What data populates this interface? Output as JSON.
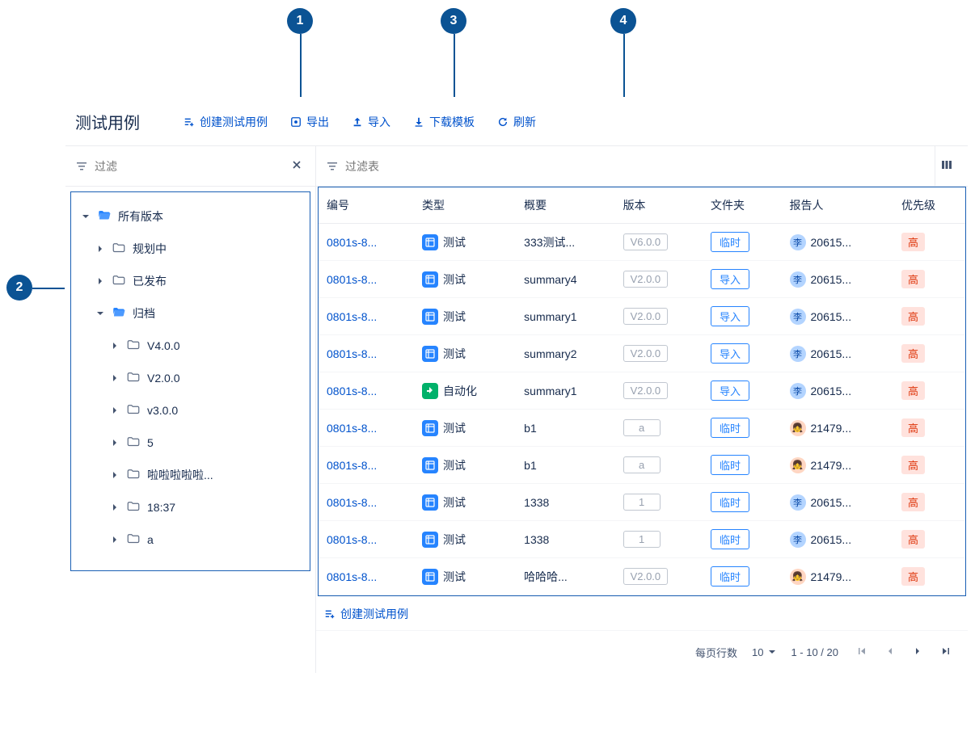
{
  "header": {
    "title": "测试用例",
    "create_label": "创建测试用例",
    "export_label": "导出",
    "import_label": "导入",
    "download_template_label": "下载模板",
    "refresh_label": "刷新"
  },
  "sidebar": {
    "filter_placeholder": "过滤",
    "tree": [
      {
        "depth": 0,
        "expanded": true,
        "open_folder": true,
        "label": "所有版本"
      },
      {
        "depth": 1,
        "expanded": false,
        "open_folder": false,
        "label": "规划中"
      },
      {
        "depth": 1,
        "expanded": false,
        "open_folder": false,
        "label": "已发布"
      },
      {
        "depth": 1,
        "expanded": true,
        "open_folder": true,
        "label": "归档"
      },
      {
        "depth": 2,
        "expanded": false,
        "open_folder": false,
        "label": "V4.0.0"
      },
      {
        "depth": 2,
        "expanded": false,
        "open_folder": false,
        "label": "V2.0.0"
      },
      {
        "depth": 2,
        "expanded": false,
        "open_folder": false,
        "label": "v3.0.0"
      },
      {
        "depth": 2,
        "expanded": false,
        "open_folder": false,
        "label": "5"
      },
      {
        "depth": 2,
        "expanded": false,
        "open_folder": false,
        "label": "啦啦啦啦啦..."
      },
      {
        "depth": 2,
        "expanded": false,
        "open_folder": false,
        "label": "18:37"
      },
      {
        "depth": 2,
        "expanded": false,
        "open_folder": false,
        "label": "a"
      }
    ]
  },
  "content": {
    "filter_placeholder": "过滤表",
    "columns": {
      "id": "编号",
      "type": "类型",
      "summary": "概要",
      "version": "版本",
      "folder": "文件夹",
      "reporter": "报告人",
      "priority": "优先级"
    },
    "rows": [
      {
        "id": "0801s-8...",
        "type_label": "测试",
        "type_variant": "blue",
        "summary": "333测试...",
        "version": "V6.0.0",
        "folder": "临时",
        "reporter": "20615...",
        "avatar": "blue",
        "priority": "高"
      },
      {
        "id": "0801s-8...",
        "type_label": "测试",
        "type_variant": "blue",
        "summary": "summary4",
        "version": "V2.0.0",
        "folder": "导入",
        "reporter": "20615...",
        "avatar": "blue",
        "priority": "高"
      },
      {
        "id": "0801s-8...",
        "type_label": "测试",
        "type_variant": "blue",
        "summary": "summary1",
        "version": "V2.0.0",
        "folder": "导入",
        "reporter": "20615...",
        "avatar": "blue",
        "priority": "高"
      },
      {
        "id": "0801s-8...",
        "type_label": "测试",
        "type_variant": "blue",
        "summary": "summary2",
        "version": "V2.0.0",
        "folder": "导入",
        "reporter": "20615...",
        "avatar": "blue",
        "priority": "高"
      },
      {
        "id": "0801s-8...",
        "type_label": "自动化",
        "type_variant": "green",
        "summary": "summary1",
        "version": "V2.0.0",
        "folder": "导入",
        "reporter": "20615...",
        "avatar": "blue",
        "priority": "高"
      },
      {
        "id": "0801s-8...",
        "type_label": "测试",
        "type_variant": "blue",
        "summary": "b1",
        "version": "a",
        "folder": "临时",
        "reporter": "21479...",
        "avatar": "pink",
        "priority": "高"
      },
      {
        "id": "0801s-8...",
        "type_label": "测试",
        "type_variant": "blue",
        "summary": "b1",
        "version": "a",
        "folder": "临时",
        "reporter": "21479...",
        "avatar": "pink",
        "priority": "高"
      },
      {
        "id": "0801s-8...",
        "type_label": "测试",
        "type_variant": "blue",
        "summary": "1338",
        "version": "1",
        "folder": "临时",
        "reporter": "20615...",
        "avatar": "blue",
        "priority": "高"
      },
      {
        "id": "0801s-8...",
        "type_label": "测试",
        "type_variant": "blue",
        "summary": "1338",
        "version": "1",
        "folder": "临时",
        "reporter": "20615...",
        "avatar": "blue",
        "priority": "高"
      },
      {
        "id": "0801s-8...",
        "type_label": "测试",
        "type_variant": "blue",
        "summary": "哈哈哈...",
        "version": "V2.0.0",
        "folder": "临时",
        "reporter": "21479...",
        "avatar": "pink",
        "priority": "高"
      }
    ],
    "inline_create_label": "创建测试用例",
    "pagination": {
      "rows_per_page_label": "每页行数",
      "page_size": "10",
      "range": "1 - 10 / 20"
    }
  },
  "callouts": {
    "c1": "1",
    "c2": "2",
    "c3": "3",
    "c4": "4"
  }
}
